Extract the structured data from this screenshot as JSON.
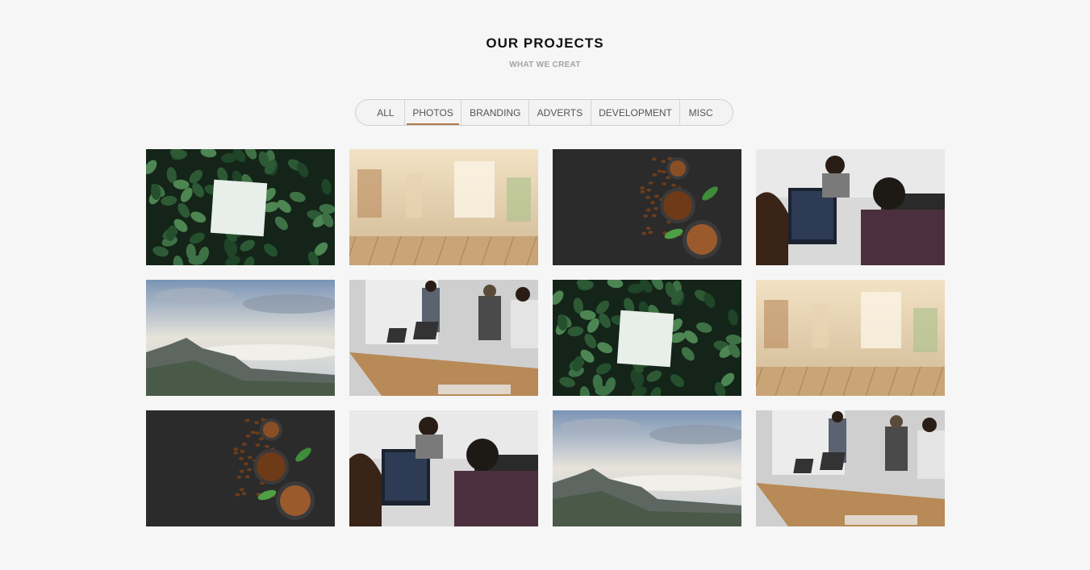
{
  "section": {
    "title": "OUR PROJECTS",
    "subtitle": "WHAT WE CREAT"
  },
  "filters": [
    {
      "label": "ALL",
      "active": false
    },
    {
      "label": "PHOTOS",
      "active": true
    },
    {
      "label": "BRANDING",
      "active": false
    },
    {
      "label": "ADVERTS",
      "active": false
    },
    {
      "label": "DEVELOPMENT",
      "active": false
    },
    {
      "label": "MISC",
      "active": false
    }
  ],
  "accent_color": "#b07c4f",
  "gallery": [
    {
      "image": "leaves-with-blank-card"
    },
    {
      "image": "blurred-cafe-with-wooden-table"
    },
    {
      "image": "coffee-beans-on-dark-slate"
    },
    {
      "image": "developers-at-computer"
    },
    {
      "image": "mountain-sky-above-clouds"
    },
    {
      "image": "office-meeting-presentation"
    },
    {
      "image": "leaves-with-blank-card"
    },
    {
      "image": "blurred-cafe-with-wooden-table"
    },
    {
      "image": "coffee-beans-on-dark-slate"
    },
    {
      "image": "developers-at-computer"
    },
    {
      "image": "mountain-sky-above-clouds"
    },
    {
      "image": "office-meeting-presentation"
    }
  ]
}
